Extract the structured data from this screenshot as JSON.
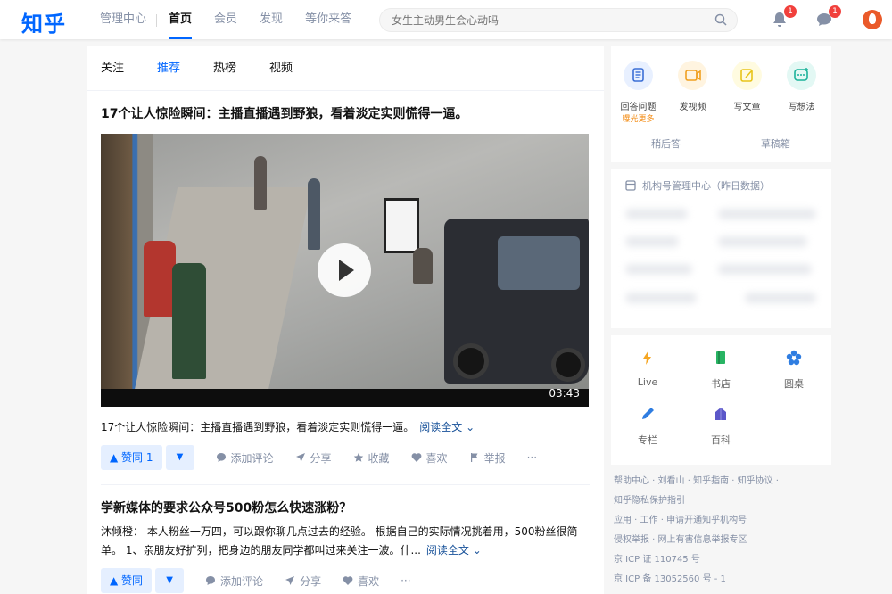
{
  "header": {
    "logo": "知乎",
    "nav": [
      "管理中心",
      "首页",
      "会员",
      "发现",
      "等你来答"
    ],
    "active_nav": "首页",
    "search_placeholder": "女生主动男生会心动吗",
    "notifications_count": "1",
    "messages_count": "1"
  },
  "feed": {
    "tabs": [
      "关注",
      "推荐",
      "热榜",
      "视频"
    ],
    "active_tab": "推荐",
    "items": [
      {
        "title": "17个让人惊险瞬间：主播直播遇到野狼，看着淡定实则慌得一逼。",
        "video_duration": "03:43",
        "excerpt": "17个让人惊险瞬间：主播直播遇到野狼，看着淡定实则慌得一逼。",
        "read_more": "阅读全文 ⌄",
        "vote_label": "▲ 赞同 1",
        "vote_down": "▼",
        "actions": [
          "添加评论",
          "分享",
          "收藏",
          "喜欢",
          "举报",
          "···"
        ]
      },
      {
        "title": "学新媒体的要求公众号500粉怎么快速涨粉？",
        "excerpt": "沐倾橙： 本人粉丝一万四，可以跟你聊几点过去的经验。 根据自己的实际情况挑着用，500粉丝很简单。 1、亲朋友好扩列，把身边的朋友同学都叫过来关注一波。什...",
        "read_more": "阅读全文 ⌄",
        "vote_label": "▲ 赞同",
        "vote_down": "▼",
        "actions": [
          "添加评论",
          "分享",
          "喜欢",
          "···"
        ]
      }
    ]
  },
  "creator_panel": {
    "items": [
      {
        "label": "回答问题",
        "sub": "曝光更多",
        "color": "#e8f0ff",
        "icon_color": "#3b6fd6",
        "icon": "answer-icon"
      },
      {
        "label": "发视频",
        "sub": "",
        "color": "#fff4e0",
        "icon_color": "#f0a020",
        "icon": "video-icon"
      },
      {
        "label": "写文章",
        "sub": "",
        "color": "#fffbe0",
        "icon_color": "#e8c41a",
        "icon": "article-icon"
      },
      {
        "label": "写想法",
        "sub": "",
        "color": "#e3f8f4",
        "icon_color": "#1bb29a",
        "icon": "idea-icon"
      }
    ],
    "later": "稍后答",
    "drafts": "草稿箱"
  },
  "org_panel": {
    "title": "机构号管理中心（昨日数据）"
  },
  "features": [
    {
      "label": "Live",
      "color": "#f5a623",
      "icon": "lightning-icon"
    },
    {
      "label": "书店",
      "color": "#28b463",
      "icon": "book-icon"
    },
    {
      "label": "圆桌",
      "color": "#2f7de1",
      "icon": "roundtable-icon"
    },
    {
      "label": "专栏",
      "color": "#2f7de1",
      "icon": "pen-icon"
    },
    {
      "label": "百科",
      "color": "#5b57c9",
      "icon": "encyclopedia-icon"
    }
  ],
  "footer": [
    "帮助中心 · 刘看山 · 知乎指南 · 知乎协议 ·",
    "知乎隐私保护指引",
    "应用 · 工作 · 申请开通知乎机构号",
    "侵权举报 · 网上有害信息举报专区",
    "京 ICP 证 110745 号",
    "京 ICP 备 13052560 号 - 1"
  ]
}
